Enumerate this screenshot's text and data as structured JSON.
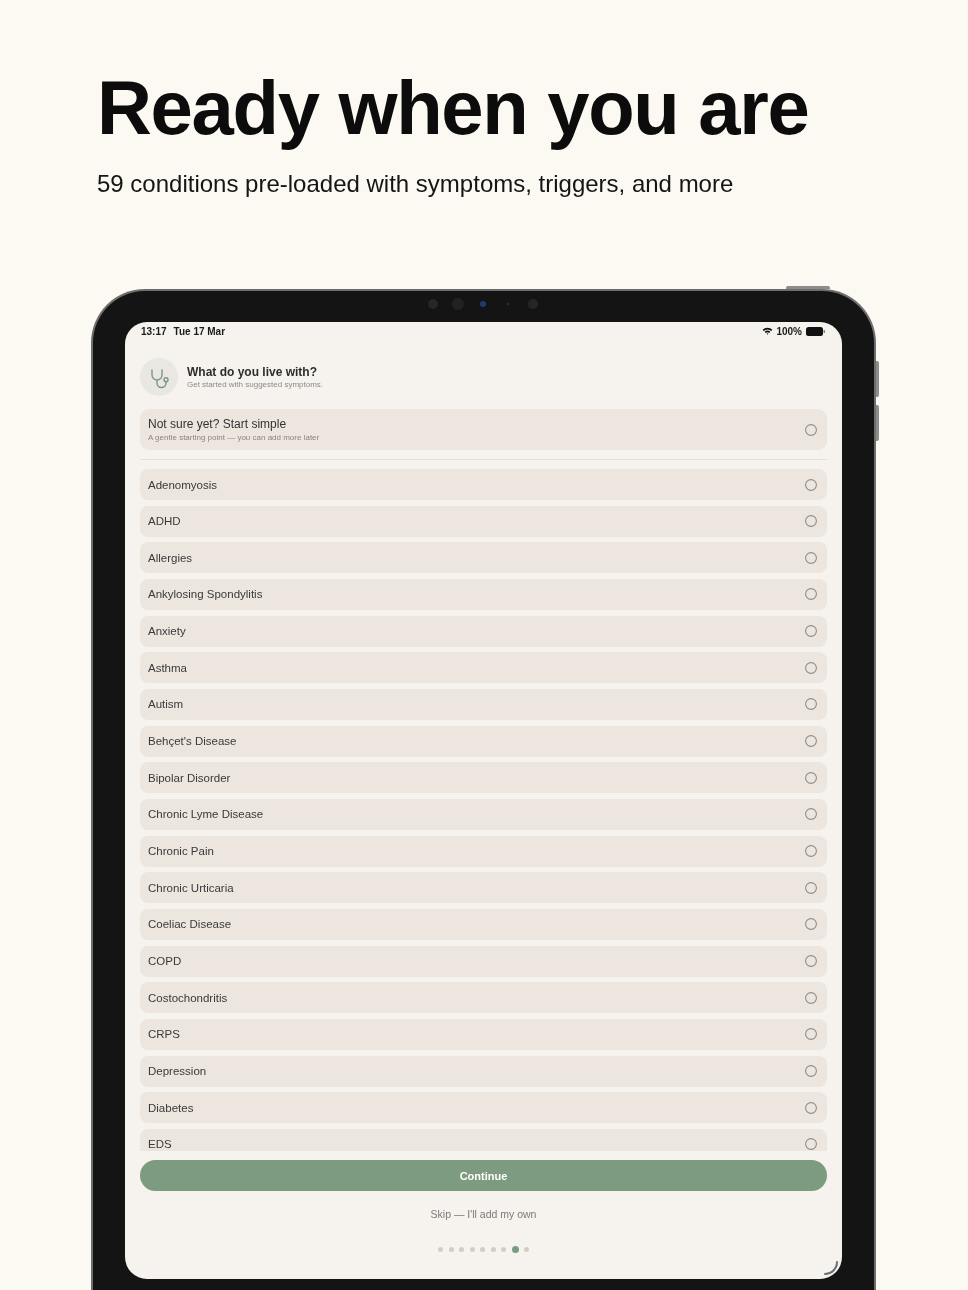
{
  "headline": {
    "title": "Ready when you are",
    "subtitle": "59 conditions pre-loaded with symptoms, triggers, and more"
  },
  "status_bar": {
    "time": "13:17",
    "date": "Tue 17 Mar",
    "battery": "100%"
  },
  "header": {
    "title": "What do you live with?",
    "subtitle": "Get started with suggested symptoms."
  },
  "start_option": {
    "title": "Not sure yet? Start simple",
    "subtitle": "A gentle starting point — you can add more later",
    "selected": false
  },
  "conditions": [
    {
      "label": "Adenomyosis",
      "selected": false
    },
    {
      "label": "ADHD",
      "selected": false
    },
    {
      "label": "Allergies",
      "selected": false
    },
    {
      "label": "Ankylosing Spondylitis",
      "selected": false
    },
    {
      "label": "Anxiety",
      "selected": false
    },
    {
      "label": "Asthma",
      "selected": false
    },
    {
      "label": "Autism",
      "selected": false
    },
    {
      "label": "Behçet's Disease",
      "selected": false
    },
    {
      "label": "Bipolar Disorder",
      "selected": false
    },
    {
      "label": "Chronic Lyme Disease",
      "selected": false
    },
    {
      "label": "Chronic Pain",
      "selected": false
    },
    {
      "label": "Chronic Urticaria",
      "selected": false
    },
    {
      "label": "Coeliac Disease",
      "selected": false
    },
    {
      "label": "COPD",
      "selected": false
    },
    {
      "label": "Costochondritis",
      "selected": false
    },
    {
      "label": "CRPS",
      "selected": false
    },
    {
      "label": "Depression",
      "selected": false
    },
    {
      "label": "Diabetes",
      "selected": false
    },
    {
      "label": "EDS",
      "selected": false
    }
  ],
  "continue_button": {
    "label": "Continue"
  },
  "skip_link": {
    "label": "Skip — I'll add my own"
  },
  "page_dots": [
    {
      "selected": false
    },
    {
      "selected": false
    },
    {
      "selected": false
    },
    {
      "selected": false
    },
    {
      "selected": false
    },
    {
      "selected": false
    },
    {
      "selected": false
    },
    {
      "selected": true
    },
    {
      "selected": false
    }
  ]
}
